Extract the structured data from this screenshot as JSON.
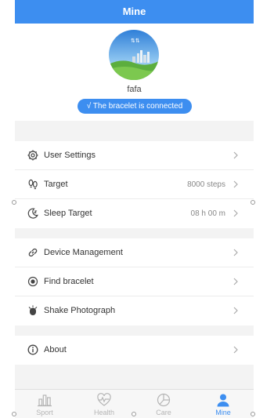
{
  "header": {
    "title": "Mine"
  },
  "profile": {
    "username": "fafa",
    "status": "√ The bracelet is connected"
  },
  "groups": [
    [
      {
        "label": "User Settings",
        "value": "",
        "icon": "gear-icon"
      },
      {
        "label": "Target",
        "value": "8000 steps",
        "icon": "footprints-icon"
      },
      {
        "label": "Sleep Target",
        "value": "08 h 00 m",
        "icon": "moon-icon"
      }
    ],
    [
      {
        "label": "Device Management",
        "value": "",
        "icon": "link-icon"
      },
      {
        "label": "Find bracelet",
        "value": "",
        "icon": "target-icon"
      },
      {
        "label": "Shake Photograph",
        "value": "",
        "icon": "shake-hand-icon"
      }
    ],
    [
      {
        "label": "About",
        "value": "",
        "icon": "info-icon"
      }
    ]
  ],
  "tabs": [
    {
      "label": "Sport",
      "icon": "bar-chart-icon",
      "active": false
    },
    {
      "label": "Health",
      "icon": "heart-pulse-icon",
      "active": false
    },
    {
      "label": "Care",
      "icon": "pie-chart-icon",
      "active": false
    },
    {
      "label": "Mine",
      "icon": "person-icon",
      "active": true
    }
  ],
  "colors": {
    "accent": "#3d8ef0",
    "background": "#f3f3f3",
    "inactive_tab": "#b5b5b5"
  }
}
